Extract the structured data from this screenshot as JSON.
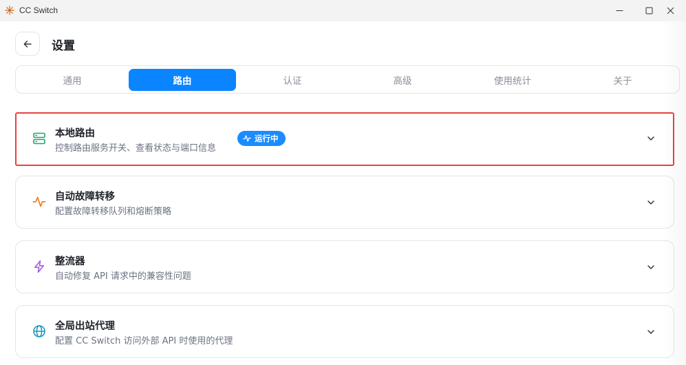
{
  "window": {
    "title": "CC Switch",
    "app_icon": "sunburst-logo-icon",
    "controls": [
      "minimize-icon",
      "maximize-icon",
      "close-icon"
    ]
  },
  "header": {
    "back_icon": "arrow-left-icon",
    "title": "设置"
  },
  "tabs": [
    {
      "label": "通用",
      "active": false
    },
    {
      "label": "路由",
      "active": true
    },
    {
      "label": "认证",
      "active": false
    },
    {
      "label": "高级",
      "active": false
    },
    {
      "label": "使用统计",
      "active": false
    },
    {
      "label": "关于",
      "active": false
    }
  ],
  "sections": [
    {
      "icon": "server-icon",
      "icon_color": "#1aa66c",
      "title": "本地路由",
      "description": "控制路由服务开关、查看状态与端口信息",
      "badge": {
        "icon": "activity-icon",
        "label": "运行中",
        "color": "#1a8cff"
      },
      "highlighted": true
    },
    {
      "icon": "pulse-icon",
      "icon_color": "#f07a1a",
      "title": "自动故障转移",
      "description": "配置故障转移队列和熔断策略"
    },
    {
      "icon": "lightning-icon",
      "icon_color": "#a45be8",
      "title": "整流器",
      "description": "自动修复 API 请求中的兼容性问题"
    },
    {
      "icon": "globe-icon",
      "icon_color": "#1a96b8",
      "title": "全局出站代理",
      "description": "配置 CC Switch 访问外部 API 时使用的代理"
    }
  ],
  "colors": {
    "accent": "#0a84ff",
    "highlight_border": "#e8403f"
  }
}
